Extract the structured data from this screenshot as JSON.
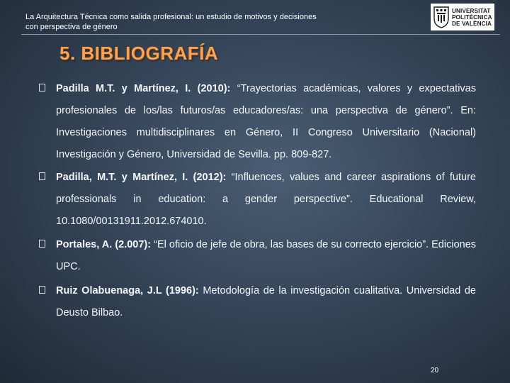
{
  "header": {
    "text": "La Arquitectura Técnica como salida profesional: un estudio de motivos y decisiones con perspectiva de género",
    "logo_lines": [
      "UNIVERSITAT",
      "POLITÈCNICA",
      "DE VALÈNCIA"
    ]
  },
  "title": "5. BIBLIOGRAFÍA",
  "references": [
    {
      "authors": "Padilla M.T. y Martínez, I. (2010):",
      "text": "“Trayectorias académicas, valores y expectativas profesionales de los/las futuros/as educadores/as: una perspectiva de género”. En: Investigaciones multidisciplinares en Género, II Congreso Universitario (Nacional) Investigación y Género, Universidad de Sevilla. pp. 809-827."
    },
    {
      "authors": "Padilla, M.T. y Martínez, I. (2012):",
      "text": "“Influences, values and career aspirations of future professionals in education: a gender perspective”. Educational Review, 10.1080/00131911.2012.674010."
    },
    {
      "authors": "Portales, A. (2.007):",
      "text": "“El oficio de jefe de obra, las bases de su correcto ejercicio”. Ediciones UPC."
    },
    {
      "authors": "Ruiz Olabuenaga, J.L (1996):",
      "text": "Metodología de la investigación cualitativa. Universidad de Deusto Bilbao."
    }
  ],
  "page_number": "20"
}
